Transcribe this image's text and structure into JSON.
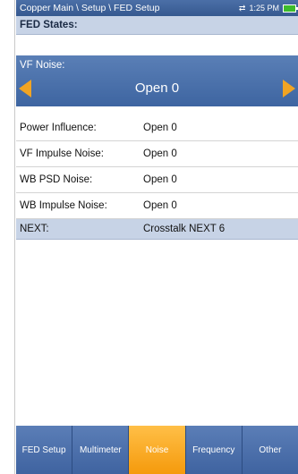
{
  "titlebar": {
    "breadcrumb": "Copper Main \\ Setup \\ FED Setup",
    "time": "1:25 PM",
    "icons": [
      "signal-icon",
      "battery-icon"
    ]
  },
  "fed_states": {
    "header": "FED States:"
  },
  "vf_noise": {
    "label": "VF Noise:",
    "value": "Open 0"
  },
  "rows": [
    {
      "label": "Power Influence:",
      "value": "Open 0"
    },
    {
      "label": "VF Impulse Noise:",
      "value": "Open 0"
    },
    {
      "label": "WB PSD Noise:",
      "value": "Open 0"
    },
    {
      "label": "WB Impulse Noise:",
      "value": "Open 0"
    }
  ],
  "next": {
    "label": "NEXT:",
    "value": "Crosstalk NEXT 6"
  },
  "tabs": [
    {
      "label": "FED Setup",
      "active": false
    },
    {
      "label": "Multimeter",
      "active": false
    },
    {
      "label": "Noise",
      "active": true
    },
    {
      "label": "Frequency",
      "active": false
    },
    {
      "label": "Other",
      "active": false
    }
  ],
  "colors": {
    "accent": "#f59a0c",
    "header_blue": "#3f63a0",
    "section_bg": "#c7d3e6"
  }
}
